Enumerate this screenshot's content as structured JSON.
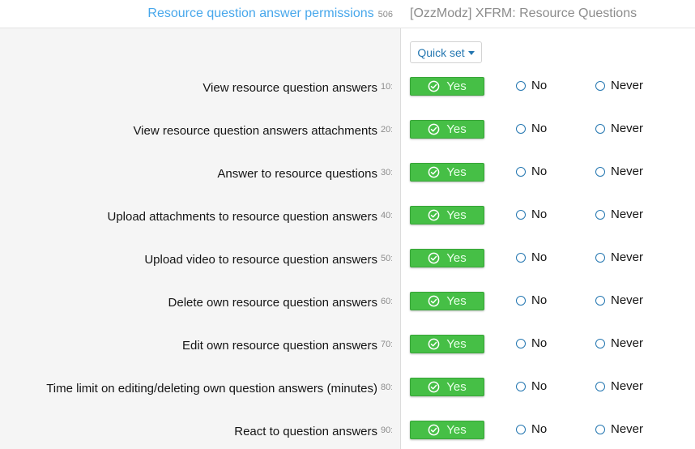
{
  "header": {
    "group_title": "Resource question answer permissions",
    "group_id": "506",
    "addon_title": "[OzzModz] XFRM: Resource Questions"
  },
  "quick_set": {
    "label": "Quick set"
  },
  "options": {
    "yes": "Yes",
    "no": "No",
    "never": "Never"
  },
  "colors": {
    "yes_green": "#46bf46",
    "link_blue": "#47a7eb",
    "radio_blue": "#2577b1"
  },
  "permissions": [
    {
      "label": "View resource question answers",
      "id": "10:",
      "selected": "yes"
    },
    {
      "label": "View resource question answers attachments",
      "id": "20:",
      "selected": "yes"
    },
    {
      "label": "Answer to resource questions",
      "id": "30:",
      "selected": "yes"
    },
    {
      "label": "Upload attachments to resource question answers",
      "id": "40:",
      "selected": "yes"
    },
    {
      "label": "Upload video to resource question answers",
      "id": "50:",
      "selected": "yes"
    },
    {
      "label": "Delete own resource question answers",
      "id": "60:",
      "selected": "yes"
    },
    {
      "label": "Edit own resource question answers",
      "id": "70:",
      "selected": "yes"
    },
    {
      "label": "Time limit on editing/deleting own question answers (minutes)",
      "id": "80:",
      "selected": "yes"
    },
    {
      "label": "React to question answers",
      "id": "90:",
      "selected": "yes"
    }
  ]
}
